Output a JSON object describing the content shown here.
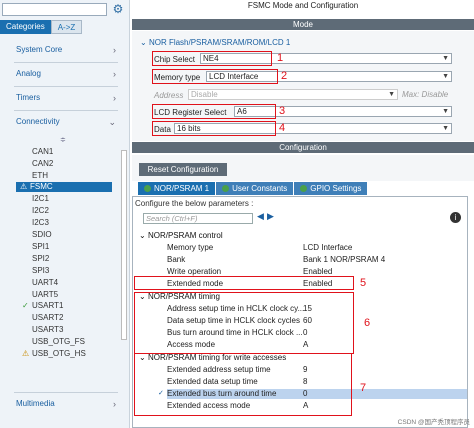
{
  "left": {
    "tabs": [
      "Categories",
      "A->Z"
    ],
    "categories": [
      {
        "label": "System Core"
      },
      {
        "label": "Analog"
      },
      {
        "label": "Timers"
      },
      {
        "label": "Connectivity"
      },
      {
        "label": "Multimedia"
      }
    ],
    "peripherals": [
      "CAN1",
      "CAN2",
      "ETH",
      "FSMC",
      "I2C1",
      "I2C2",
      "I2C3",
      "SDIO",
      "SPI1",
      "SPI2",
      "SPI3",
      "UART4",
      "UART5",
      "USART1",
      "USART2",
      "USART3",
      "USB_OTG_FS",
      "USB_OTG_HS"
    ],
    "selected": "FSMC"
  },
  "right": {
    "title": "FSMC Mode and Configuration",
    "mode_header": "Mode",
    "tree_label": "NOR Flash/PSRAM/SRAM/ROM/LCD 1",
    "chip_select": {
      "label": "Chip Select",
      "value": "NE4"
    },
    "memory_type": {
      "label": "Memory type",
      "value": "LCD Interface"
    },
    "address": {
      "label": "Address",
      "value": "Disable",
      "max_label": "Max: Disable"
    },
    "lcd_register_select": {
      "label": "LCD Register Select",
      "value": "A6"
    },
    "data": {
      "label": "Data",
      "value": "16 bits"
    },
    "config_header": "Configuration",
    "reset_button": "Reset Configuration",
    "config_tabs": [
      "NOR/PSRAM 1",
      "User Constants",
      "GPIO Settings"
    ],
    "hint": "Configure the below parameters :",
    "search_placeholder": "Search (Ctrl+F)",
    "groups": {
      "control": "NOR/PSRAM control",
      "timing": "NOR/PSRAM timing",
      "timing_write": "NOR/PSRAM timing for write accesses"
    },
    "control_params": [
      {
        "name": "Memory type",
        "value": "LCD Interface"
      },
      {
        "name": "Bank",
        "value": "Bank 1 NOR/PSRAM 4"
      },
      {
        "name": "Write operation",
        "value": "Enabled"
      },
      {
        "name": "Extended mode",
        "value": "Enabled"
      }
    ],
    "timing_params": [
      {
        "name": "Address setup time in HCLK clock cy...",
        "value": "15"
      },
      {
        "name": "Data setup time in HCLK clock cycles",
        "value": "60"
      },
      {
        "name": "Bus turn around time in HCLK clock ...",
        "value": "0"
      },
      {
        "name": "Access mode",
        "value": "A"
      }
    ],
    "write_params": [
      {
        "name": "Extended address setup time",
        "value": "9"
      },
      {
        "name": "Extended data setup time",
        "value": "8"
      },
      {
        "name": "Extended bus turn around time",
        "value": "0"
      },
      {
        "name": "Extended access mode",
        "value": "A"
      }
    ],
    "annotations": [
      "1",
      "2",
      "3",
      "4",
      "5",
      "6",
      "7"
    ],
    "watermark": "CSDN @国产秃顶程序员"
  },
  "colors": {
    "accent": "#1a6fb0",
    "header": "#5e6b77",
    "annotation": "#e0121b",
    "selected_row": "#bcd3ee"
  }
}
